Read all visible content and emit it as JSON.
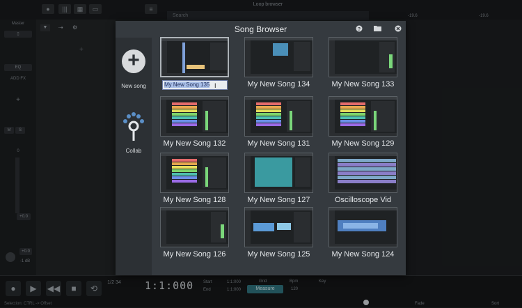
{
  "background": {
    "loop_browser_title": "Loop browser",
    "search_placeholder": "Search",
    "strip": {
      "master": "Master",
      "eq": "EQ",
      "add_fx": "ADD FX",
      "add": "+",
      "m": "M",
      "s": "S",
      "vol": "0",
      "gain1": "+0.0",
      "gain2": "+0.0",
      "gain3": "-1 dB"
    },
    "meter_left": "-19.6",
    "meter_right": "-19.6",
    "time": "1:1:000",
    "start_label": "Start",
    "end_label": "End",
    "start_value": "1:1:000",
    "end_value": "1:1:000",
    "grid_label": "Grid",
    "measure_label": "Measure",
    "bpm_label": "Bpm",
    "bpm_value": "120",
    "key_label": "Key",
    "time_sig": "1/2 34",
    "status": "Selection: CTRL -> Offset",
    "fade_label": "Fade",
    "sort_label": "Sort"
  },
  "dialog": {
    "title": "Song Browser",
    "icons": [
      "help-icon",
      "folder-icon",
      "close-icon"
    ],
    "sidebar": {
      "new_song": "New song",
      "collab": "Collab"
    },
    "rename_value": "My New Song 135",
    "songs": [
      {
        "name": "My New Song 135"
      },
      {
        "name": "My New Song 134"
      },
      {
        "name": "My New Song 133"
      },
      {
        "name": "My New Song 132"
      },
      {
        "name": "My New Song 131"
      },
      {
        "name": "My New Song 129"
      },
      {
        "name": "My New Song 128"
      },
      {
        "name": "My New Song 127"
      },
      {
        "name": "Oscilloscope Vid"
      },
      {
        "name": "My New Song 126"
      },
      {
        "name": "My New Song 125"
      },
      {
        "name": "My New Song 124"
      }
    ],
    "accent": "#2e6e78"
  }
}
